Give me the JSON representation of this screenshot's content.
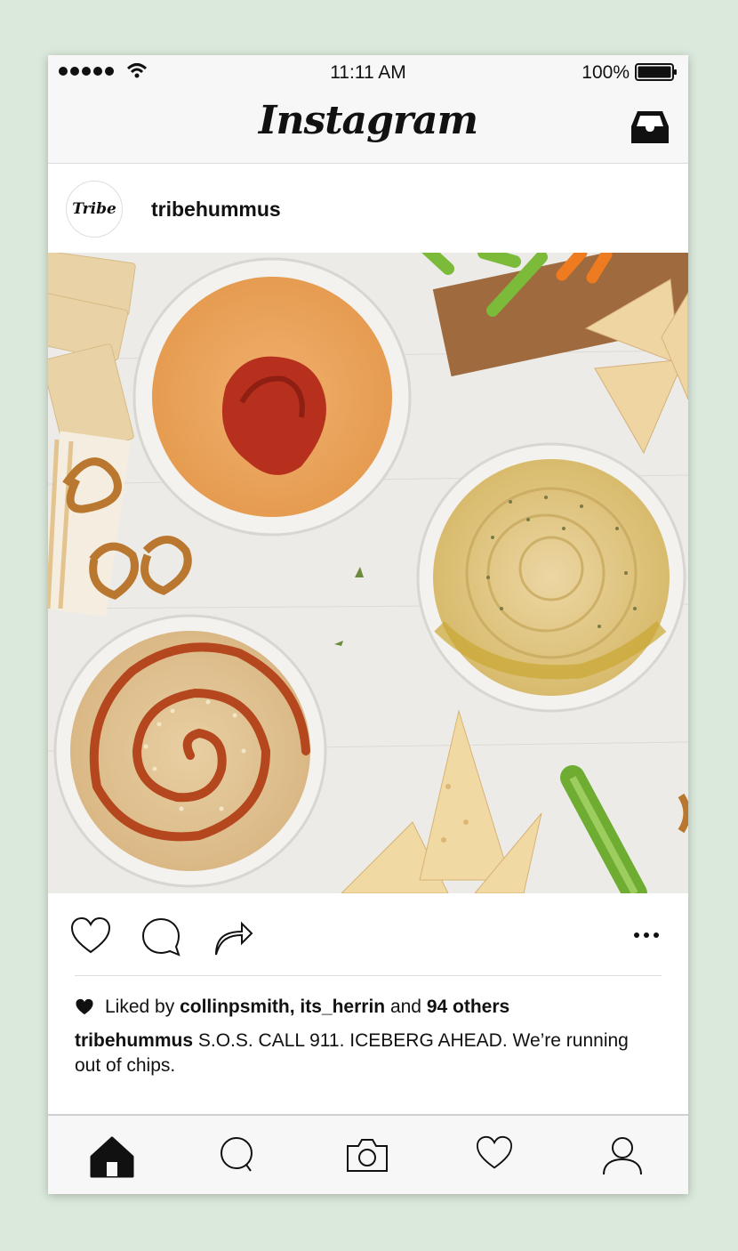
{
  "status_bar": {
    "time": "11:11 AM",
    "battery": "100%"
  },
  "header": {
    "app_title": "Instagram",
    "inbox_icon": "inbox-icon"
  },
  "post": {
    "avatar_text": "Tribe",
    "username": "tribehummus",
    "likes": {
      "prefix": "Liked by",
      "users": "collinpsmith, its_herrin",
      "and": "and",
      "others": "94 others"
    },
    "caption_user": "tribehummus",
    "caption_text": "S.O.S. CALL 911. ICEBERG AHEAD. We’re running out of chips."
  },
  "actions": [
    "heart-icon",
    "comment-icon",
    "share-icon",
    "more-icon"
  ],
  "tabbar": [
    "home-icon",
    "search-icon",
    "camera-icon",
    "heart-icon",
    "profile-icon"
  ],
  "colors": {
    "background": "#dbe9dc",
    "bar": "#f7f7f7",
    "text": "#111111"
  }
}
